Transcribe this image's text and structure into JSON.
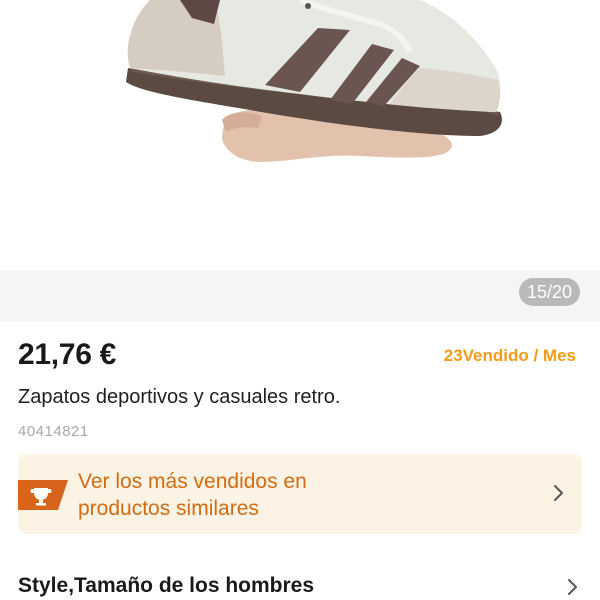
{
  "gallery": {
    "image_icon": "sneaker-photo",
    "counter": "15/20"
  },
  "product": {
    "price": "21,76 €",
    "sold": "23Vendido / Mes",
    "title": "Zapatos deportivos y casuales retro.",
    "sku": "40414821"
  },
  "promo": {
    "icon": "trophy-icon",
    "text_line1": "Ver los más vendidos en",
    "text_line2": "productos similares",
    "accent_color": "#d26b12",
    "background_color": "#fdf3e4"
  },
  "options": {
    "label": "Style,Tamaño de los hombres"
  }
}
